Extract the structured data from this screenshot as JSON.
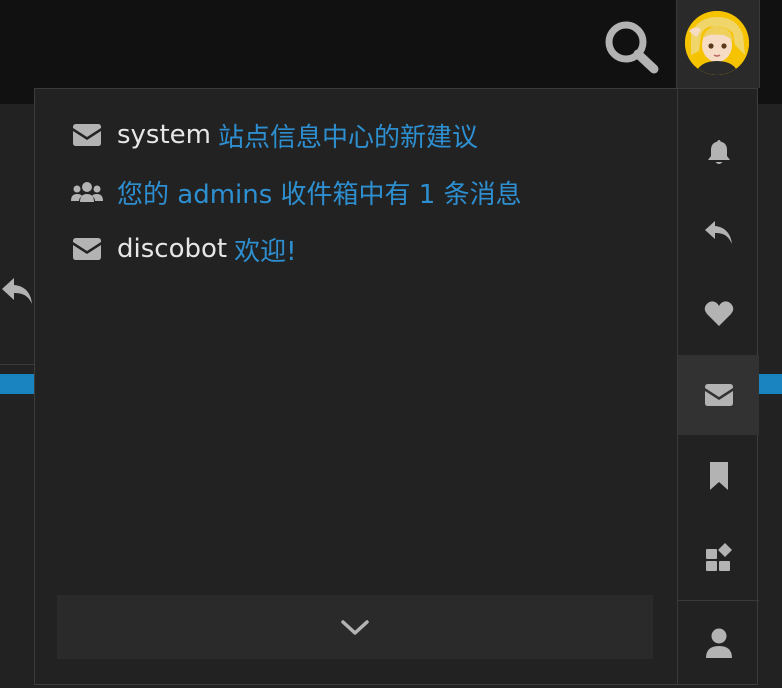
{
  "header": {
    "search_icon": "search-icon",
    "avatar_icon": "user-avatar"
  },
  "notifications": {
    "items": [
      {
        "icon": "envelope-icon",
        "user": "system",
        "message": "站点信息中心的新建议"
      },
      {
        "icon": "users-icon",
        "user": "",
        "message": "您的 admins 收件箱中有 1 条消息"
      },
      {
        "icon": "envelope-icon",
        "user": "discobot",
        "message": "欢迎!"
      }
    ],
    "more_icon": "chevron-down-icon"
  },
  "tabs": [
    {
      "name": "all-notifications",
      "icon": "bell-icon"
    },
    {
      "name": "replies",
      "icon": "reply-icon"
    },
    {
      "name": "likes",
      "icon": "heart-icon"
    },
    {
      "name": "messages",
      "icon": "envelope-icon",
      "active": true
    },
    {
      "name": "bookmarks",
      "icon": "bookmark-icon"
    },
    {
      "name": "review",
      "icon": "review-icon"
    },
    {
      "name": "profile",
      "icon": "user-icon"
    }
  ],
  "colors": {
    "link": "#2e8fd0",
    "text": "#e6e6e6",
    "icon": "#b3b3b3",
    "header_bg": "#111111",
    "panel_bg": "#222222",
    "active_tab_bg": "#323232",
    "accent_strip": "#1a84c0"
  }
}
